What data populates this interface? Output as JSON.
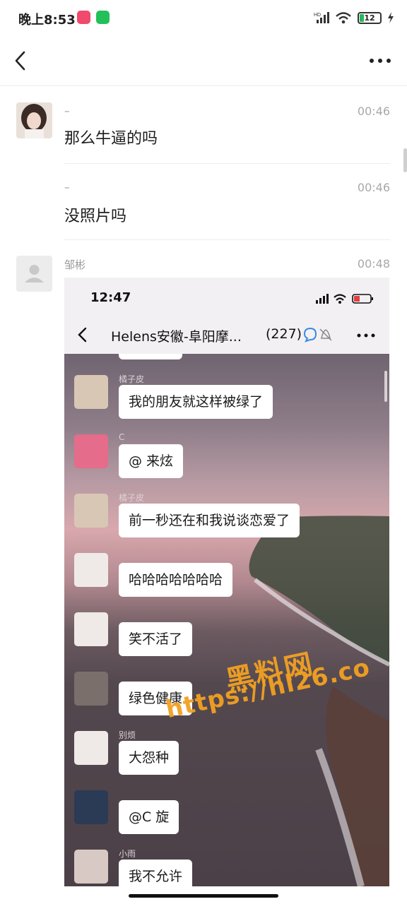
{
  "status_bar": {
    "time": "晚上8:53",
    "battery": "12",
    "network": "HD"
  },
  "nav": {
    "back_icon": "chevron-left-icon",
    "more_icon": "more-dots-icon"
  },
  "messages": [
    {
      "sender": "–",
      "time": "00:46",
      "text": "那么牛逼的吗"
    },
    {
      "sender": "–",
      "time": "00:46",
      "text": "没照片吗"
    },
    {
      "sender": "邹彬",
      "time": "00:48"
    }
  ],
  "shot": {
    "status_time": "12:47",
    "title": "Helens安徽-阜阳摩...",
    "count": "(227)",
    "chat": [
      {
        "name": "橘子皮",
        "text": "我的朋友就这样被绿了"
      },
      {
        "name": "C",
        "text": "@ 来炫"
      },
      {
        "name": "橘子皮",
        "text": "前一秒还在和我说谈恋爱了"
      },
      {
        "name": "",
        "text": "哈哈哈哈哈哈哈"
      },
      {
        "name": "",
        "text": "笑不活了"
      },
      {
        "name": "",
        "text": "绿色健康"
      },
      {
        "name": "别烦",
        "text": "大怨种"
      },
      {
        "name": "",
        "text": "@C 旋"
      },
      {
        "name": "小雨",
        "text": "我不允许"
      }
    ]
  },
  "watermark": {
    "line1": "黑料网",
    "line2": "https://hl26.co"
  },
  "colors": {
    "accent_orange": "#f2a122",
    "bubble": "#ffffff"
  }
}
